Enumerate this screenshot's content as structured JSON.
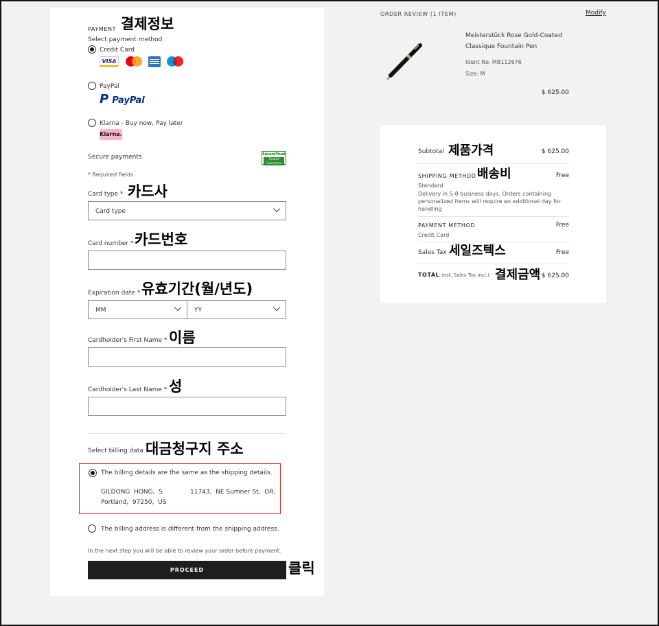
{
  "annotations": {
    "payment": "결제정보",
    "card_type": "카드사",
    "card_number": "카드번호",
    "expiration": "유효기간(월/년도)",
    "first_name": "이름",
    "last_name": "성",
    "billing": "대금청구지 주소",
    "subtotal": "제품가격",
    "shipping": "배송비",
    "sales_tax": "세일즈텍스",
    "total": "결제금액",
    "click": "클릭"
  },
  "payment": {
    "heading": "PAYMENT",
    "select_label": "Select payment method",
    "methods": [
      {
        "label": "Credit Card",
        "selected": true
      },
      {
        "label": "PayPal",
        "selected": false
      },
      {
        "label": "Klarna - Buy now, Pay later",
        "selected": false
      }
    ],
    "card_brands": [
      "VISA",
      "mastercard",
      "AMEX",
      "maestro"
    ],
    "paypal_logo": "PayPal",
    "klarna_logo": "Klarna.",
    "secure_label": "Secure payments",
    "secure_badge_top": "SecureTrust",
    "secure_badge_mid": "Trusted Commerce",
    "required_note": "* Required fields"
  },
  "form": {
    "card_type_label": "Card type *",
    "card_type_value": "Card type",
    "card_number_label": "Card number *",
    "card_number_value": "",
    "expiration_label": "Expiration date *",
    "month_value": "MM",
    "year_value": "YY",
    "first_name_label": "Cardholder's First Name *",
    "first_name_value": "",
    "last_name_label": "Cardholder's Last Name *",
    "last_name_value": ""
  },
  "billing": {
    "label": "Select billing data",
    "same_option": "The billing details are the same as the shipping details.",
    "address_line1": "GILDONG  HONG,  S              11743,  NE Sumner St,  OR,",
    "address_line2": "Portland,  97250,  US",
    "different_option": "The billing address is different from the shipping address.",
    "note": "In the next step you will be able to review your order before payment.",
    "proceed": "PROCEED"
  },
  "order": {
    "title": "ORDER REVIEW (1 ITEM)",
    "modify": "Modify",
    "item_name_1": "Meisterstück Rose Gold-Coated",
    "item_name_2": "Classique Fountain Pen",
    "ident": "Ident No. MB112676",
    "size": "Size: M",
    "price": "$ 625.00"
  },
  "summary": {
    "subtotal_label": "Subtotal",
    "subtotal_value": "$ 625.00",
    "shipping_label": "SHIPPING METHOD",
    "shipping_value": "Free",
    "shipping_type": "Standard",
    "shipping_desc_1": "Delivery in 5-8 business days. Orders containing",
    "shipping_desc_2": "personalized items will require an additional day for",
    "shipping_desc_3": "handling",
    "payment_label": "PAYMENT METHOD",
    "payment_value": "Free",
    "payment_type": "Credit Card",
    "tax_label": "Sales Tax",
    "tax_value": "Free",
    "total_label": "TOTAL",
    "total_note": "(est. Sales Tax incl.)",
    "total_value": "$ 625.00"
  },
  "colors": {
    "page_bg": "#f2f2f2",
    "button_bg": "#1e1e1e",
    "highlight_border": "#d32f2f",
    "paypal_blue": "#003087",
    "klarna_pink": "#ffb3c7"
  }
}
